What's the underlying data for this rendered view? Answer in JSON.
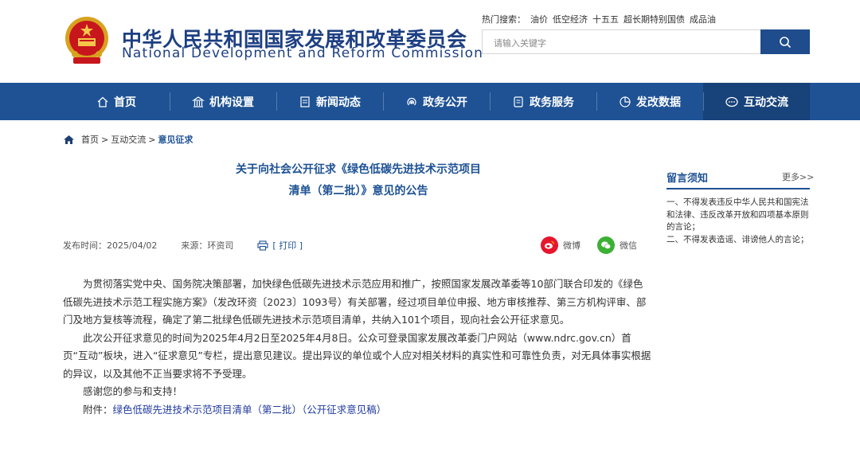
{
  "header": {
    "site_name_cn": "中华人民共和国国家发展和改革委员会",
    "site_name_en": "National Development and Reform Commission",
    "hot_label": "热门搜索：",
    "hot_terms": [
      "油价",
      "低空经济",
      "十五五",
      "超长期特别国债",
      "成品油"
    ],
    "search_placeholder": "请输入关键字"
  },
  "nav": {
    "items": [
      {
        "label": "首页",
        "icon": "home-icon"
      },
      {
        "label": "机构设置",
        "icon": "building-icon"
      },
      {
        "label": "新闻动态",
        "icon": "news-icon"
      },
      {
        "label": "政务公开",
        "icon": "broadcast-icon"
      },
      {
        "label": "政务服务",
        "icon": "document-icon"
      },
      {
        "label": "发改数据",
        "icon": "pie-chart-icon"
      },
      {
        "label": "互动交流",
        "icon": "chat-icon"
      }
    ],
    "active_index": 6,
    "colors": {
      "bar": "#1e5294",
      "active": "#17427a"
    }
  },
  "breadcrumb": {
    "items": [
      "首页",
      "互动交流",
      "意见征求"
    ],
    "separator": ">"
  },
  "article": {
    "title_line1": "关于向社会公开征求《绿色低碳先进技术示范项目",
    "title_line2": "清单（第二批）》意见的公告",
    "publish_time": "发布时间：2025/04/02",
    "source": "来源：环资司",
    "print_label": "[ 打印 ]",
    "share": {
      "weibo": "微博",
      "wechat": "微信"
    },
    "paragraphs": [
      "为贯彻落实党中央、国务院决策部署，加快绿色低碳先进技术示范应用和推广，按照国家发展改革委等10部门联合印发的《绿色低碳先进技术示范工程实施方案》（发改环资〔2023〕1093号）有关部署，经过项目单位申报、地方审核推荐、第三方机构评审、部门及地方复核等流程，确定了第二批绿色低碳先进技术示范项目清单，共纳入101个项目，现向社会公开征求意见。",
      "此次公开征求意见的时间为2025年4月2日至2025年4月8日。公众可登录国家发展改革委门户网站（www.ndrc.gov.cn）首页“互动”板块，进入“征求意见”专栏，提出意见建议。提出异议的单位或个人应对相关材料的真实性和可靠性负责，对无具体事实根据的异议，以及其他不正当要求将不予受理。",
      "感谢您的参与和支持！"
    ],
    "attachment_label": "附件：",
    "attachment_link": "绿色低碳先进技术示范项目清单（第二批）（公开征求意见稿）"
  },
  "sidebar": {
    "title": "留言须知",
    "more": "更多>>",
    "notes": [
      "一、不得发表违反中华人民共和国宪法和法律、违反改革开放和四项基本原则的言论；",
      "二、不得发表造谣、诽谤他人的言论；"
    ]
  }
}
